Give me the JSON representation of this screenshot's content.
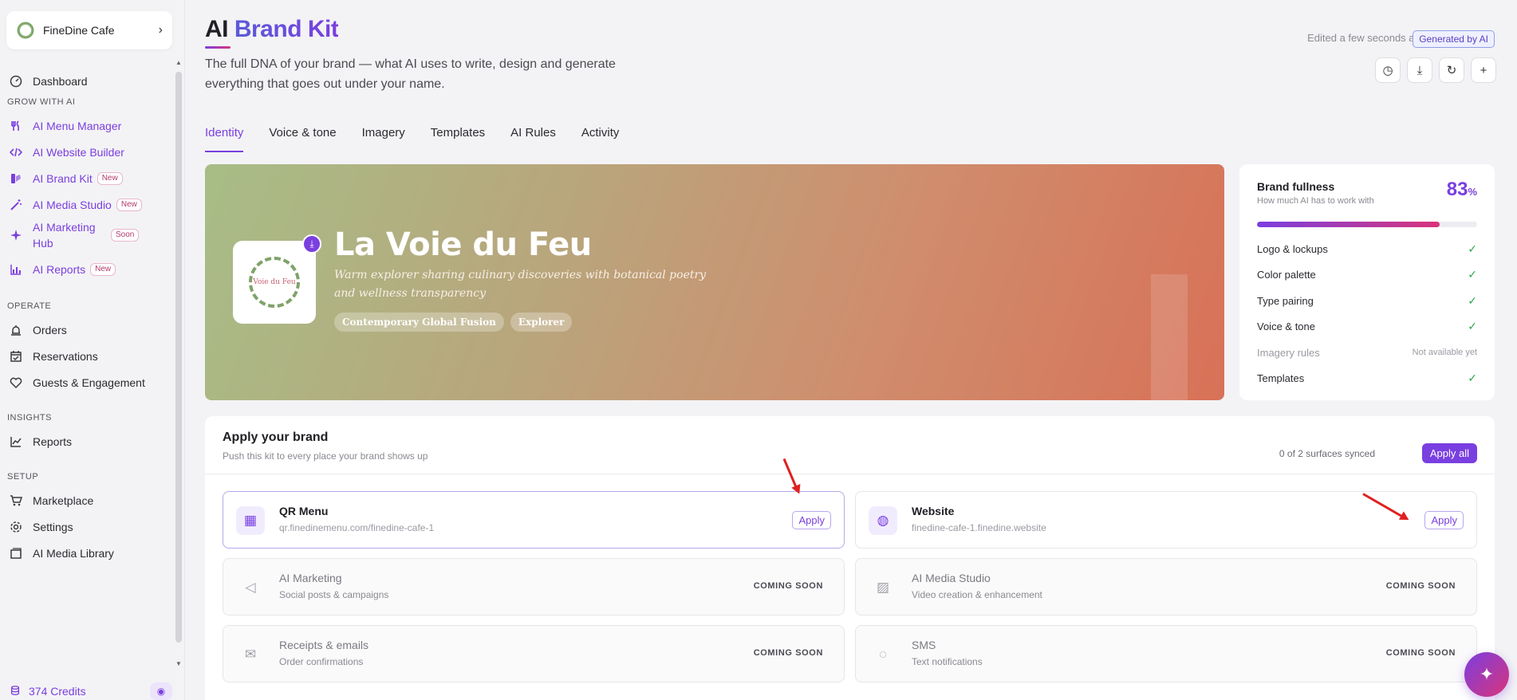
{
  "sidebar": {
    "restaurant": "FineDine Cafe",
    "items": [
      {
        "label": "Dashboard",
        "icon": "gauge-icon",
        "ai": false,
        "badge": ""
      },
      {
        "label": "AI Menu Manager",
        "icon": "fork-knife-icon",
        "ai": true,
        "badge": ""
      },
      {
        "label": "AI Website Builder",
        "icon": "code-icon",
        "ai": true,
        "badge": ""
      },
      {
        "label": "AI Brand Kit",
        "icon": "palette-icon",
        "ai": true,
        "badge": "New"
      },
      {
        "label": "AI Media Studio",
        "icon": "magic-wand-icon",
        "ai": true,
        "badge": "New"
      },
      {
        "label": "AI Marketing Hub",
        "icon": "sparkle-icon",
        "ai": true,
        "badge": "Soon"
      },
      {
        "label": "AI Reports",
        "icon": "chart-icon",
        "ai": true,
        "badge": "New"
      },
      {
        "label": "Orders",
        "icon": "bell-icon",
        "ai": false,
        "badge": ""
      },
      {
        "label": "Reservations",
        "icon": "calendar-icon",
        "ai": false,
        "badge": ""
      },
      {
        "label": "Guests & Engagement",
        "icon": "heart-icon",
        "ai": false,
        "badge": ""
      },
      {
        "label": "Reports",
        "icon": "line-chart-icon",
        "ai": false,
        "badge": ""
      },
      {
        "label": "Marketplace",
        "icon": "cart-icon",
        "ai": false,
        "badge": ""
      },
      {
        "label": "Settings",
        "icon": "gear-icon",
        "ai": false,
        "badge": ""
      },
      {
        "label": "AI Media Library",
        "icon": "gallery-icon",
        "ai": false,
        "badge": ""
      }
    ],
    "sections": [
      "GROW WITH AI",
      "OPERATE",
      "INSIGHTS",
      "SETUP"
    ],
    "credits": "374 Credits"
  },
  "header": {
    "title_1": "AI",
    "title_2": "Brand Kit",
    "subtitle": "The full DNA of your brand — what AI uses to write, design and generate everything that goes out under your name.",
    "edited": "Edited a few seconds ago",
    "generated_badge": "Generated by AI"
  },
  "tabs": [
    "Identity",
    "Voice & tone",
    "Imagery",
    "Templates",
    "AI Rules",
    "Activity"
  ],
  "hero": {
    "brand_name": "La Voie du Feu",
    "tagline": "Warm explorer sharing culinary discoveries with botanical poetry and wellness transparency",
    "chips": [
      "Contemporary Global Fusion",
      "Explorer"
    ],
    "logo_text": "Voie du Feu"
  },
  "fullness": {
    "title": "Brand fullness",
    "subtitle": "How much AI has to work with",
    "percent": "83",
    "percent_sign": "%",
    "progress_fraction": 0.83,
    "items": [
      {
        "label": "Logo & lockups",
        "status": "✓",
        "available": true
      },
      {
        "label": "Color palette",
        "status": "✓",
        "available": true
      },
      {
        "label": "Type pairing",
        "status": "✓",
        "available": true
      },
      {
        "label": "Voice & tone",
        "status": "✓",
        "available": true
      },
      {
        "label": "Imagery rules",
        "status": "Not available yet",
        "available": false
      },
      {
        "label": "Templates",
        "status": "✓",
        "available": true
      }
    ]
  },
  "apply": {
    "title": "Apply your brand",
    "subtitle": "Push this kit to every place your brand shows up",
    "synced": "0 of 2 surfaces synced",
    "apply_all": "Apply all",
    "surfaces": [
      {
        "name": "QR Menu",
        "desc": "qr.finedinemenu.com/finedine-cafe-1",
        "action": "Apply",
        "icon": "qr-code-icon",
        "soon": false
      },
      {
        "name": "Website",
        "desc": "finedine-cafe-1.finedine.website",
        "action": "Apply",
        "icon": "globe-icon",
        "soon": false
      },
      {
        "name": "AI Marketing",
        "desc": "Social posts & campaigns",
        "action": "COMING SOON",
        "icon": "megaphone-icon",
        "soon": true
      },
      {
        "name": "AI Media Studio",
        "desc": "Video creation & enhancement",
        "action": "COMING SOON",
        "icon": "image-icon",
        "soon": true
      },
      {
        "name": "Receipts & emails",
        "desc": "Order confirmations",
        "action": "COMING SOON",
        "icon": "mail-icon",
        "soon": true
      },
      {
        "name": "SMS",
        "desc": "Text notifications",
        "action": "COMING SOON",
        "icon": "chat-bubble-icon",
        "soon": true
      }
    ]
  },
  "colors": {
    "accent": "#7a3fe0",
    "accent_pink": "#d9347a",
    "check": "#2fa44a",
    "annotation_arrow": "#e02020"
  }
}
